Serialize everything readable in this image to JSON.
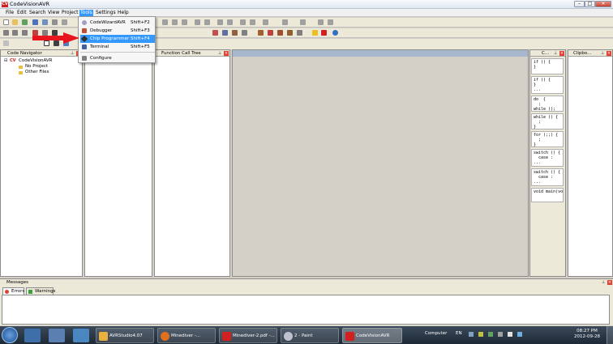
{
  "window": {
    "title": "CodeVisionAVR",
    "app_icon": "CV"
  },
  "menubar": {
    "items": [
      "File",
      "Edit",
      "Search",
      "View",
      "Project",
      "Tools",
      "Settings",
      "Help"
    ],
    "active": "Tools"
  },
  "tools_menu": [
    {
      "label": "CodeWizardAVR",
      "shortcut": "Shift+F2",
      "icon": "wizard-icon"
    },
    {
      "label": "Debugger",
      "shortcut": "Shift+F3",
      "icon": "debugger-icon"
    },
    {
      "label": "Chip Programmer",
      "shortcut": "Shift+F4",
      "icon": "chip-programmer-icon",
      "highlighted": true
    },
    {
      "label": "Terminal",
      "shortcut": "Shift+F5",
      "icon": "terminal-icon"
    },
    {
      "label": "Configure",
      "shortcut": "",
      "icon": "configure-icon"
    }
  ],
  "panels": {
    "code_navigator": {
      "title": "Code Navigator",
      "root": "CodeVisionAVR",
      "children": [
        "No Project",
        "Other Files"
      ]
    },
    "function_call_tree": {
      "title": "Function Call Tree"
    },
    "code_templates": {
      "title": "C...",
      "snippets": [
        "if () {\n}",
        "if () {\n}\n...",
        "do  {\n  ;\nwhile ();",
        "while () {\n  ;\n}",
        "for (;;) {\n  ;\n}",
        "switch () {\n  case :\n...",
        "switch () {\n  case :\n...",
        "void main(vo"
      ]
    },
    "clipboard": {
      "title": "Clipbo..."
    },
    "messages": {
      "title": "Messages",
      "tabs": [
        "Errors",
        "Warnings"
      ]
    }
  },
  "taskbar": {
    "tasks": [
      "AVRStudio4.07",
      "Minediver -...",
      "Minediver-2.pdf -...",
      "2 - Paint",
      "CodeVisionAVR"
    ],
    "tray": {
      "computer": "Computer",
      "lang": "EN",
      "time": "08:27 PM",
      "date": "2012-09-28"
    }
  },
  "colors": {
    "accent": "#3399ff",
    "annotation_arrow": "#e8141e",
    "close": "#e04030"
  }
}
